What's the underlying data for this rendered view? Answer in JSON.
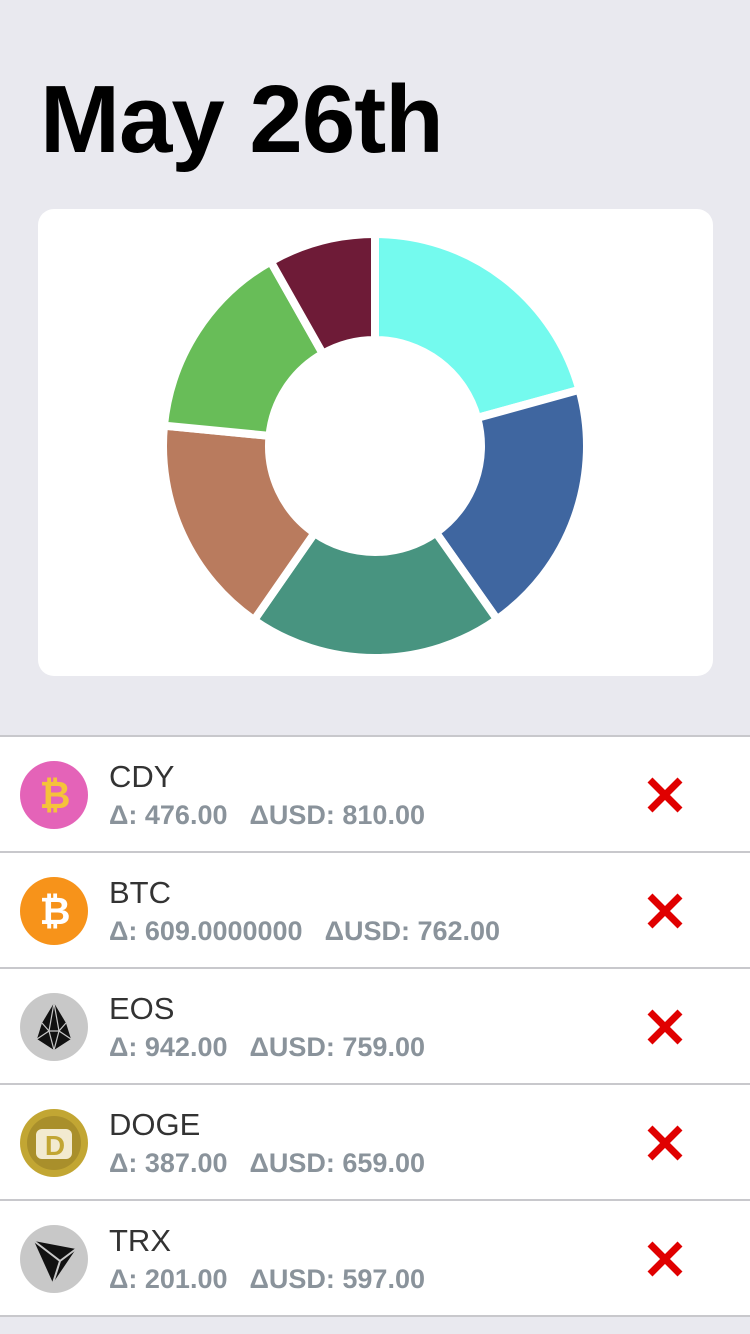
{
  "header": {
    "title": "May 26th"
  },
  "chart_data": {
    "type": "pie",
    "donut": true,
    "slices": [
      {
        "symbol": "CDY",
        "value": 810.0,
        "color": "#74faee"
      },
      {
        "symbol": "BTC",
        "value": 762.0,
        "color": "#3f66a0"
      },
      {
        "symbol": "EOS",
        "value": 759.0,
        "color": "#489480"
      },
      {
        "symbol": "DOGE",
        "value": 659.0,
        "color": "#b97b5e"
      },
      {
        "symbol": "TRX",
        "value": 597.0,
        "color": "#68bd58"
      },
      {
        "symbol": "",
        "value": 320.0,
        "color": "#6e1b37"
      }
    ]
  },
  "coins": [
    {
      "symbol": "CDY",
      "delta": "Δ: 476.00",
      "delta_usd": "ΔUSD: 810.00",
      "icon": "bitcoin-candy-icon"
    },
    {
      "symbol": "BTC",
      "delta": "Δ: 609.0000000",
      "delta_usd": "ΔUSD: 762.00",
      "icon": "bitcoin-icon"
    },
    {
      "symbol": "EOS",
      "delta": "Δ: 942.00",
      "delta_usd": "ΔUSD: 759.00",
      "icon": "eos-icon"
    },
    {
      "symbol": "DOGE",
      "delta": "Δ: 387.00",
      "delta_usd": "ΔUSD: 659.00",
      "icon": "dogecoin-icon"
    },
    {
      "symbol": "TRX",
      "delta": "Δ: 201.00",
      "delta_usd": "ΔUSD: 597.00",
      "icon": "tron-icon"
    }
  ],
  "colors": {
    "remove": "#e00000",
    "meta_text": "#8a939b",
    "background": "#e9e9ef"
  }
}
